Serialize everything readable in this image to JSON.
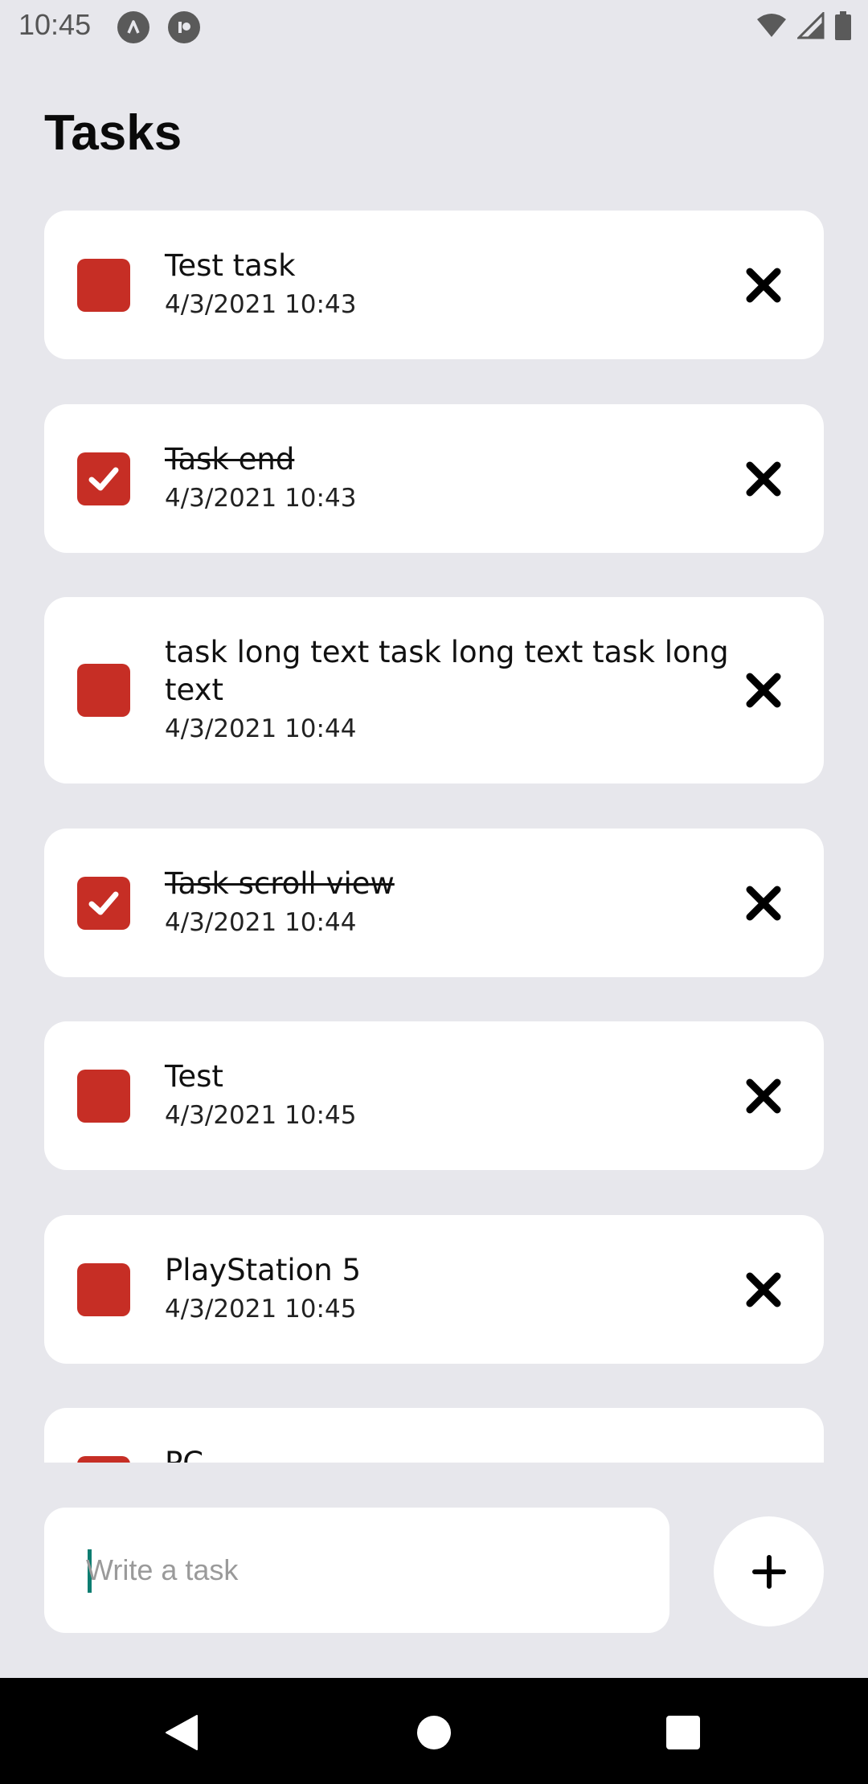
{
  "status_bar": {
    "time": "10:45",
    "app_icons": [
      "app-notification-icon-a",
      "app-notification-icon-b"
    ],
    "right_icons": [
      "wifi-icon",
      "cellular-signal-icon",
      "battery-icon"
    ]
  },
  "header": {
    "title": "Tasks"
  },
  "accent_color": "#c62e25",
  "tasks": [
    {
      "title": "Test task",
      "date": "4/3/2021 10:43",
      "completed": false
    },
    {
      "title": "Task end",
      "date": "4/3/2021 10:43",
      "completed": true
    },
    {
      "title": "task long text task long text task long text",
      "date": "4/3/2021 10:44",
      "completed": false
    },
    {
      "title": "Task scroll view",
      "date": "4/3/2021 10:44",
      "completed": true
    },
    {
      "title": "Test",
      "date": "4/3/2021 10:45",
      "completed": false
    },
    {
      "title": "PlayStation 5",
      "date": "4/3/2021 10:45",
      "completed": false
    },
    {
      "title": "PC",
      "date": "",
      "completed": false
    }
  ],
  "composer": {
    "placeholder": "Write a task",
    "value": "",
    "add_icon": "plus-icon"
  },
  "navigation": {
    "buttons": [
      "back-icon",
      "home-icon",
      "recents-icon"
    ]
  }
}
